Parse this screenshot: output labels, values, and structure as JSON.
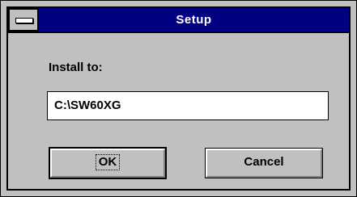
{
  "window": {
    "title": "Setup"
  },
  "dialog": {
    "install_label": "Install to:",
    "install_path": "C:\\SW60XG",
    "ok_label": "OK",
    "cancel_label": "Cancel"
  },
  "colors": {
    "titlebar": "#000080",
    "face": "#c0c0c0",
    "field": "#ffffff"
  }
}
